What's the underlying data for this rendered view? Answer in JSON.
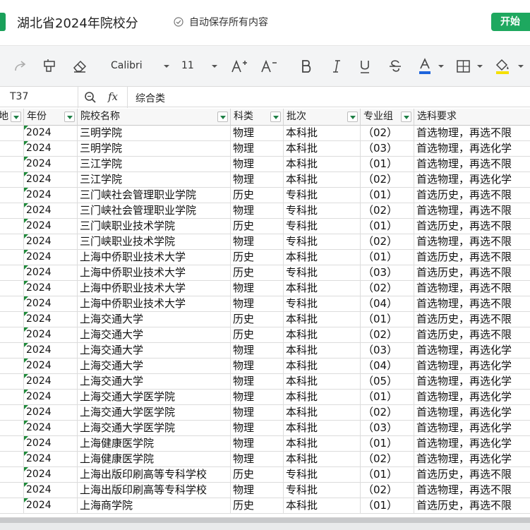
{
  "title_bar": {
    "doc_title": "湖北省2024年院校分",
    "autosave_text": "自动保存所有内容",
    "start_label": "开始"
  },
  "toolbar": {
    "font_name": "Calibri",
    "font_size": "11",
    "underline_color": "#1e64dc",
    "fill_color": "#f5e000"
  },
  "formula_bar": {
    "cell_ref": "T37",
    "fx_label": "fx",
    "value": "综合类"
  },
  "sheet": {
    "headers": [
      "地",
      "年份",
      "院校名称",
      "科类",
      "批次",
      "专业组",
      "选科要求"
    ],
    "rows": [
      [
        "",
        "2024",
        "三明学院",
        "物理",
        "本科批",
        "（02）",
        "首选物理，再选不限"
      ],
      [
        "",
        "2024",
        "三明学院",
        "物理",
        "本科批",
        "（03）",
        "首选物理，再选化学"
      ],
      [
        "",
        "2024",
        "三江学院",
        "物理",
        "本科批",
        "（01）",
        "首选物理，再选不限"
      ],
      [
        "",
        "2024",
        "三江学院",
        "物理",
        "本科批",
        "（02）",
        "首选物理，再选化学"
      ],
      [
        "",
        "2024",
        "三门峡社会管理职业学院",
        "历史",
        "专科批",
        "（01）",
        "首选历史，再选不限"
      ],
      [
        "",
        "2024",
        "三门峡社会管理职业学院",
        "物理",
        "专科批",
        "（02）",
        "首选物理，再选不限"
      ],
      [
        "",
        "2024",
        "三门峡职业技术学院",
        "历史",
        "专科批",
        "（01）",
        "首选历史，再选不限"
      ],
      [
        "",
        "2024",
        "三门峡职业技术学院",
        "物理",
        "专科批",
        "（02）",
        "首选物理，再选不限"
      ],
      [
        "",
        "2024",
        "上海中侨职业技术大学",
        "历史",
        "本科批",
        "（01）",
        "首选历史，再选不限"
      ],
      [
        "",
        "2024",
        "上海中侨职业技术大学",
        "历史",
        "专科批",
        "（03）",
        "首选历史，再选不限"
      ],
      [
        "",
        "2024",
        "上海中侨职业技术大学",
        "物理",
        "本科批",
        "（02）",
        "首选物理，再选不限"
      ],
      [
        "",
        "2024",
        "上海中侨职业技术大学",
        "物理",
        "专科批",
        "（04）",
        "首选物理，再选不限"
      ],
      [
        "",
        "2024",
        "上海交通大学",
        "历史",
        "本科批",
        "（01）",
        "首选历史，再选不限"
      ],
      [
        "",
        "2024",
        "上海交通大学",
        "历史",
        "本科批",
        "（02）",
        "首选历史，再选不限"
      ],
      [
        "",
        "2024",
        "上海交通大学",
        "物理",
        "本科批",
        "（03）",
        "首选物理，再选化学"
      ],
      [
        "",
        "2024",
        "上海交通大学",
        "物理",
        "本科批",
        "（04）",
        "首选物理，再选化学"
      ],
      [
        "",
        "2024",
        "上海交通大学",
        "物理",
        "本科批",
        "（05）",
        "首选物理，再选化学"
      ],
      [
        "",
        "2024",
        "上海交通大学医学院",
        "物理",
        "本科批",
        "（01）",
        "首选物理，再选化学"
      ],
      [
        "",
        "2024",
        "上海交通大学医学院",
        "物理",
        "本科批",
        "（02）",
        "首选物理，再选化学"
      ],
      [
        "",
        "2024",
        "上海交通大学医学院",
        "物理",
        "本科批",
        "（03）",
        "首选物理，再选化学"
      ],
      [
        "",
        "2024",
        "上海健康医学院",
        "物理",
        "本科批",
        "（01）",
        "首选物理，再选化学"
      ],
      [
        "",
        "2024",
        "上海健康医学院",
        "物理",
        "本科批",
        "（02）",
        "首选物理，再选化学"
      ],
      [
        "",
        "2024",
        "上海出版印刷高等专科学校",
        "历史",
        "专科批",
        "（01）",
        "首选历史，再选不限"
      ],
      [
        "",
        "2024",
        "上海出版印刷高等专科学校",
        "物理",
        "专科批",
        "（02）",
        "首选物理，再选不限"
      ],
      [
        "",
        "2024",
        "上海商学院",
        "历史",
        "本科批",
        "（01）",
        "首选历史，再选不限"
      ]
    ]
  }
}
